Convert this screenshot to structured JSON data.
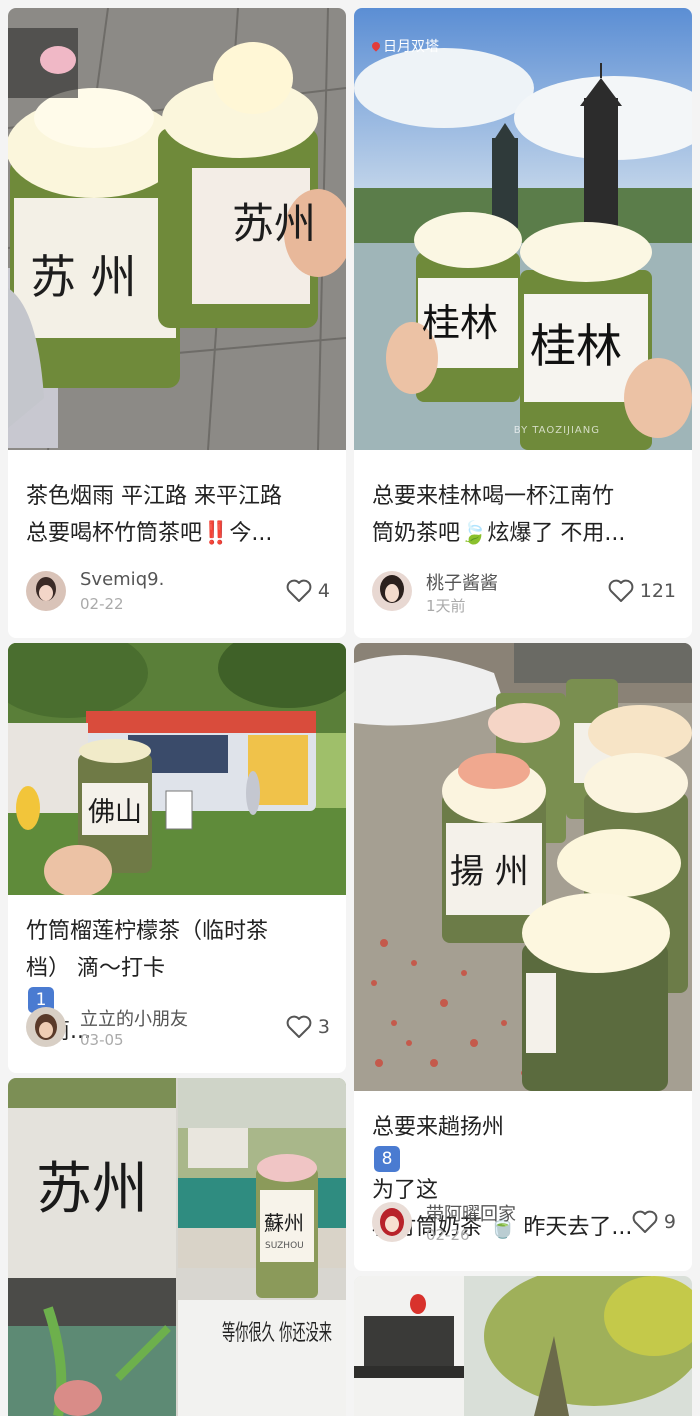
{
  "feed": {
    "posts": [
      {
        "title_line1": "茶色烟雨 平江路 来平江路",
        "title_line2_text": "总要喝杯竹筒茶吧",
        "title_line2_badge": "‼️",
        "title_line2_tail": "今...",
        "author": "Svemiq9.",
        "date": "02-22",
        "likes": "4",
        "cup_label_1": "苏 州",
        "cup_label_2": "苏州"
      },
      {
        "title_line1": "总要来桂林喝一杯江南竹",
        "title_line2_text": "筒奶茶吧",
        "title_line2_badge": "🍃",
        "title_line2_tail": "炫爆了 不用...",
        "author": "桃子酱酱",
        "date": "1天前",
        "likes": "121",
        "location": "日月双塔",
        "cup_label": "桂林",
        "watermark": "BY TAOZIJIANG"
      },
      {
        "title_line1": "竹筒榴莲柠檬茶（临时茶",
        "title_line2_text": "档） 滴～打卡",
        "title_line2_badge": "1",
        "title_line2_tail": "竹筒...",
        "author": "立立的小朋友",
        "date": "03-05",
        "likes": "3",
        "cup_label": "佛山"
      },
      {
        "title_line1_text": "总要来趟扬州",
        "title_line1_badge": "8",
        "title_line1_tail": "为了这",
        "title_line2_text": "杯竹筒奶茶",
        "title_line2_badge": "🍵",
        "title_line2_tail": "昨天去了...",
        "author": "带阿曜回家",
        "date": "02-26",
        "likes": "9",
        "cup_label": "揚 州"
      },
      {
        "wall_text": "苏州",
        "cup_label": "蘇州",
        "cup_sub": "SUZHOU",
        "note_text": "等你很久 你还没来"
      },
      {}
    ]
  },
  "colors": {
    "card_bg": "#ffffff",
    "page_bg": "#f4f4f4",
    "text_primary": "#222222",
    "text_secondary": "#555555",
    "text_muted": "#aaaaaa",
    "bamboo_green": "#6f8a3a",
    "like_icon": "#555555"
  },
  "icons": {
    "like": "heart-outline-icon",
    "location": "location-pin-icon"
  }
}
